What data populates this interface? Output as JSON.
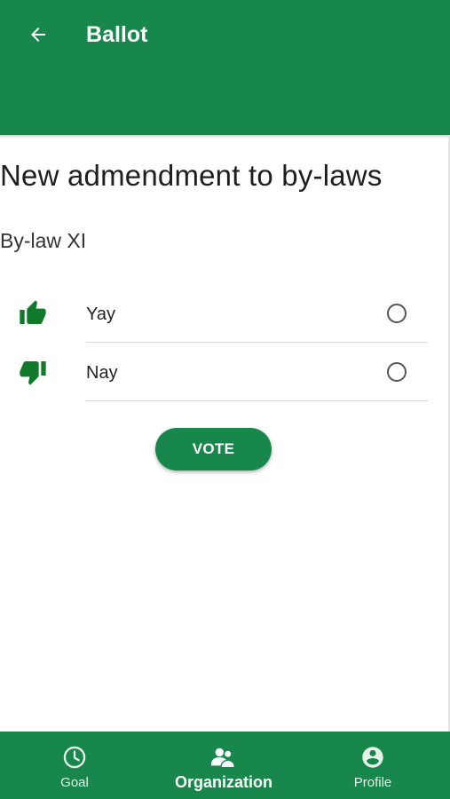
{
  "appbar": {
    "title": "Ballot",
    "back_icon": "arrow-back-icon",
    "color": "#17874b"
  },
  "ballot": {
    "title": "New admendment to by-laws",
    "subtitle": "By-law XI",
    "options": [
      {
        "label": "Yay",
        "icon": "thumbs-up-icon",
        "selected": false
      },
      {
        "label": "Nay",
        "icon": "thumbs-down-icon",
        "selected": false
      }
    ],
    "vote_label": "VOTE",
    "icon_color": "#0f7a2a"
  },
  "bottom_nav": {
    "items": [
      {
        "label": "Goal",
        "icon": "clock-icon",
        "active": false
      },
      {
        "label": "Organization",
        "icon": "group-icon",
        "active": true
      },
      {
        "label": "Profile",
        "icon": "account-circle-icon",
        "active": false
      }
    ]
  }
}
